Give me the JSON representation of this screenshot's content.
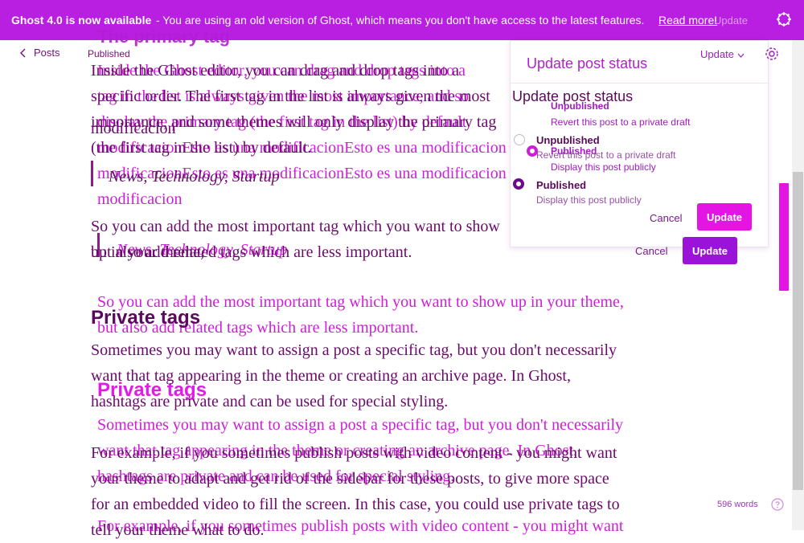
{
  "banner": {
    "title": "Ghost 4.0 is now available",
    "message": "- You are using an old version of Ghost, which means you don't have access to the latest features.",
    "link": "Read more!",
    "ghost_update": "Update"
  },
  "nav": {
    "back_label": "Posts",
    "status": "Published"
  },
  "popover": {
    "title": "Update post status",
    "title_ghost": "Update post status",
    "update_menu": "Update",
    "options": [
      {
        "label": "Unpublished",
        "description": "Revert this post to a private draft",
        "selected": false
      },
      {
        "label": "Published",
        "description": "Display this post publicly",
        "selected": true
      }
    ],
    "cancel_label": "Cancel",
    "update_label": "Update"
  },
  "editor": {
    "heading_primary": "The primary tag",
    "para_primary": "Inside the Ghost editor, you can drag and drop tags into a specific order. The first tag in the list is always given the most importance, and some themes will only display the primary tag (the first tag in the list) by default.",
    "para_primary_ghost_1": "Inside the Ghost editor, you can drag and drop tags into a",
    "para_primary_ghost_2": "tag in the list is always given the most importance, and so",
    "para_primary_ghost_3": "display the primary tag (the first tag in the list) by default",
    "modification_line": "modificacionEsto es una modificacionEsto es una modificacion",
    "modification_end": "modificacion",
    "quote": "News, Technology, Startup",
    "para_important_1": "So you can add the most important tag which you want to show up in your theme,",
    "para_important_2": "but also add related tags which are less important.",
    "heading_private": "Private tags",
    "para_private_1": "Sometimes you may want to assign a post a specific tag, but you don't necessarily",
    "para_private_2": "want that tag appearing in the theme or creating an archive page. In Ghost,",
    "para_private_3": "hashtags are private and can be used for special styling.",
    "para_example_1": "For example, if you sometimes publish posts with video content - you might want",
    "para_example_2": "your theme to adapt and get rid of the sidebar for these posts, to give more space",
    "para_example_3": "for an embedded video to fill the screen. In this case, you could use private tags to",
    "para_example_4": "tell your theme what to do."
  },
  "footer": {
    "word_count": "596 words"
  },
  "colors": {
    "brand": "#b81fe0",
    "accent": "#e414e4",
    "update_button": "#9b12d8"
  },
  "icons": [
    "close-icon",
    "chevron-left-icon",
    "gear-icon",
    "chevron-down-icon",
    "help-icon"
  ]
}
